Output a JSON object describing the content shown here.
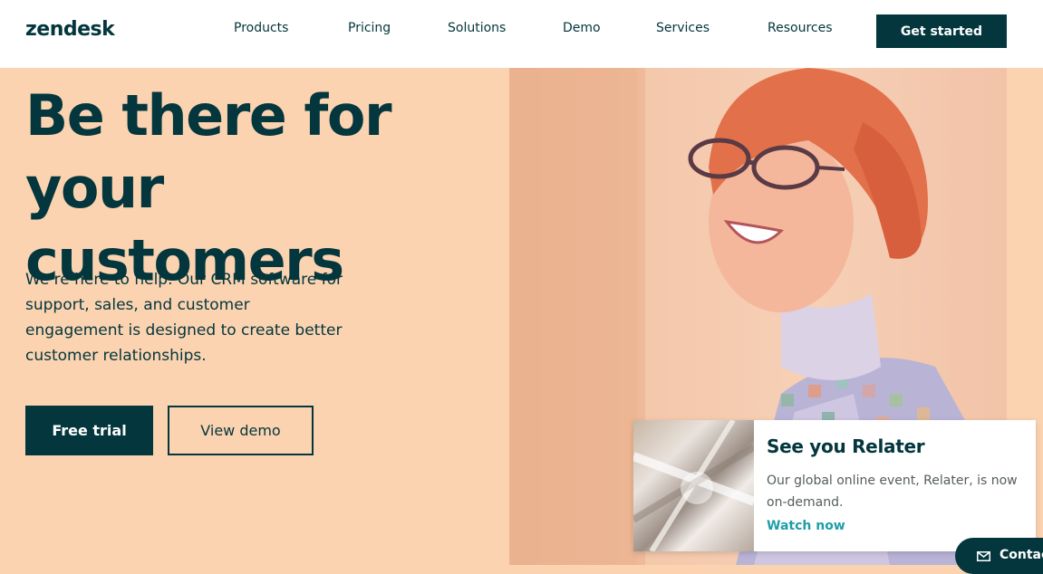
{
  "nav": {
    "logo": "zendesk",
    "items": [
      "Products",
      "Pricing",
      "Solutions",
      "Demo",
      "Services",
      "Resources"
    ],
    "cta": "Get started"
  },
  "hero": {
    "title_line1": "Be there for your",
    "title_line2": "customers",
    "subtitle": "We’re here to help. Our CRM software for support, sales, and customer engagement is designed to create better customer relationships.",
    "primary_button": "Free trial",
    "secondary_button": "View demo"
  },
  "promo": {
    "title": "See you Relater",
    "text": "Our global online event, Relater, is now on-demand.",
    "link": "Watch now"
  },
  "contact": {
    "label": "Contact",
    "icon": "mail-icon"
  },
  "colors": {
    "brand": "#03363d",
    "background": "#fbd3b0",
    "link": "#1f9ea8"
  }
}
